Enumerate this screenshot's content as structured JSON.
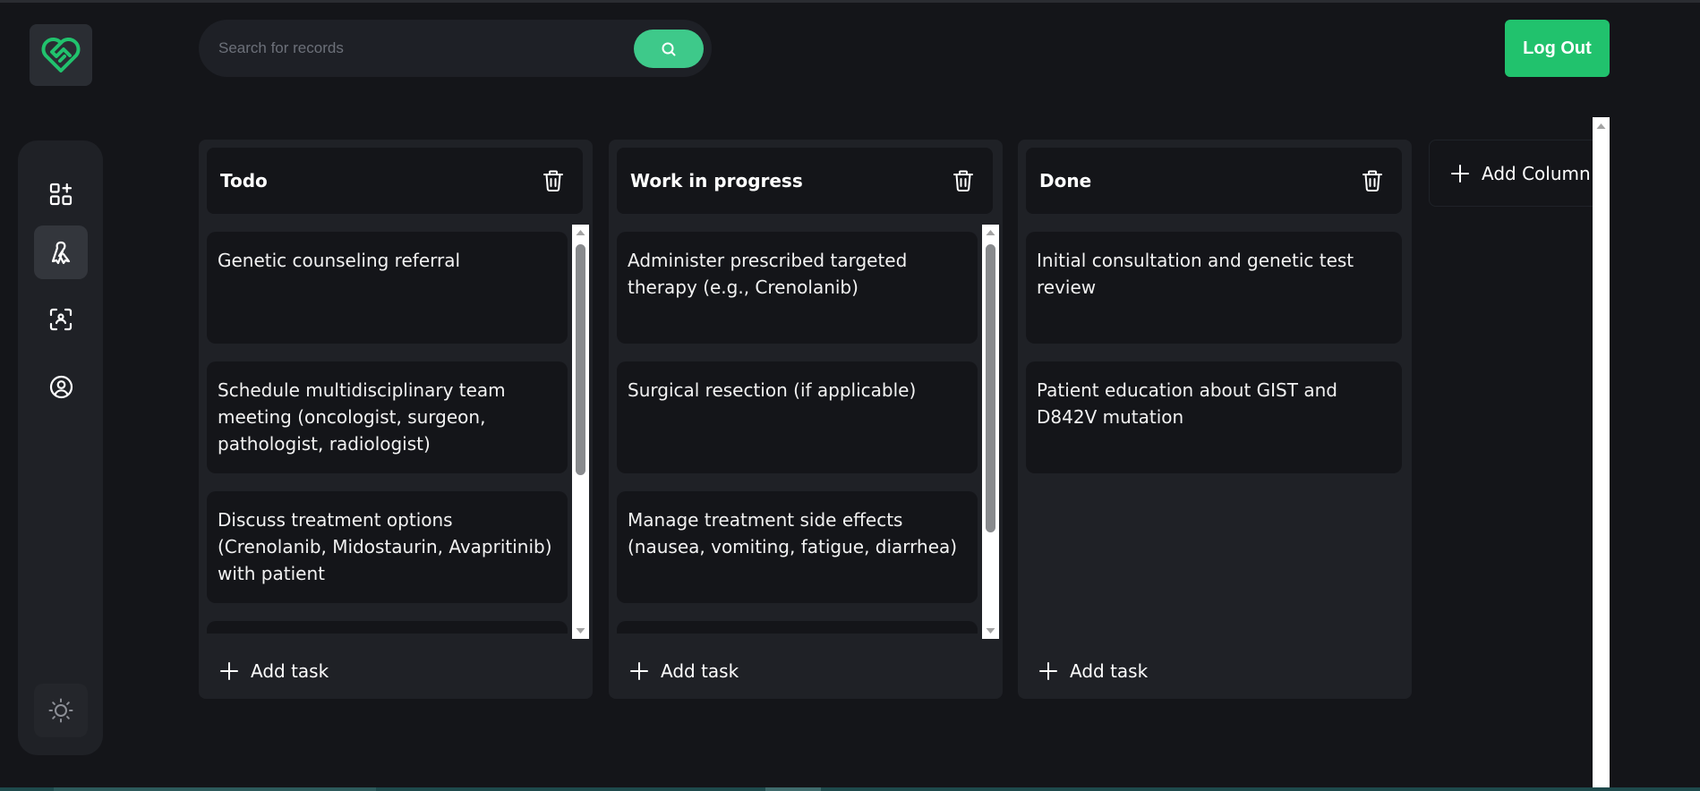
{
  "search": {
    "placeholder": "Search for records"
  },
  "header": {
    "logout_label": "Log Out"
  },
  "sidebar": {
    "items": [
      {
        "icon": "dashboard-add-icon",
        "active": false
      },
      {
        "icon": "ribbon-icon",
        "active": true
      },
      {
        "icon": "scan-user-icon",
        "active": false
      },
      {
        "icon": "user-circle-icon",
        "active": false
      }
    ],
    "theme_icon": "sun-icon"
  },
  "board": {
    "add_task_label": "Add task",
    "add_column_label": "Add Column",
    "columns": [
      {
        "title": "Todo",
        "tasks": [
          "Genetic counseling referral",
          "Schedule multidisciplinary team meeting (oncologist, surgeon, pathologist, radiologist)",
          "Discuss treatment options (Crenolanib, Midostaurin, Avapritinib) with patient",
          ""
        ]
      },
      {
        "title": "Work in progress",
        "tasks": [
          "Administer prescribed targeted therapy (e.g., Crenolanib)",
          "Surgical resection (if applicable)",
          "Manage treatment side effects (nausea, vomiting, fatigue, diarrhea)",
          ""
        ]
      },
      {
        "title": "Done",
        "tasks": [
          "Initial consultation and genetic test review",
          "Patient education about GIST and D842V mutation"
        ]
      }
    ]
  },
  "colors": {
    "accent": "#21c26d",
    "search_button": "#3ec98a",
    "background": "#141519",
    "panel": "#1f2126"
  }
}
